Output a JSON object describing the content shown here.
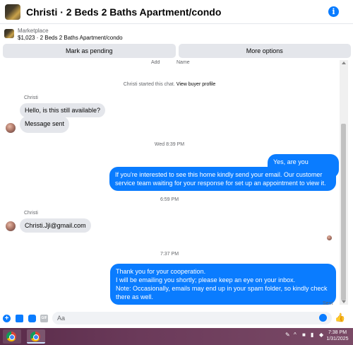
{
  "header": {
    "title": "Christi · 2 Beds 2 Baths Apartment/condo",
    "info_icon": "info-icon"
  },
  "listing": {
    "source": "Marketplace",
    "price_title": "$1,023 · 2 Beds 2 Baths Apartment/condo"
  },
  "actions": {
    "mark_pending": "Mark as pending",
    "more_options": "More options"
  },
  "messages": {
    "cut_text_1": "Add",
    "cut_text_2": "Name",
    "system_start": "Christi started this chat.",
    "system_link": "View buyer profile",
    "sender_1": "Christi",
    "in_1": "Hello, is this still available?",
    "in_2": "Message sent",
    "time_1": "Wed 8:39 PM",
    "out_1": "Yes, are you interested?",
    "out_2": "If you're interested to see this home kindly send your email. Our customer service team waiting for your response for set up an appointment to view it.",
    "time_2": "6:59 PM",
    "sender_2": "Christi",
    "in_3": "Christi.Jjl@gmail.com",
    "time_3": "7:37 PM",
    "out_3_line1": "Thank you for your cooperation.",
    "out_3_line2": "I will be emailing you shortly; please keep an eye on your inbox.",
    "out_3_line3": "Note: Occasionally, emails may end up in your spam folder, so kindly check there as well.",
    "status": "Sent"
  },
  "composer": {
    "placeholder": "Aa",
    "gif_label": "GIF"
  },
  "taskbar": {
    "time": "7:38 PM",
    "date": "1/31/2025"
  },
  "colors": {
    "accent": "#0a7cff",
    "bubble_in": "#e4e6eb",
    "taskbar": "#6b3a5a"
  }
}
